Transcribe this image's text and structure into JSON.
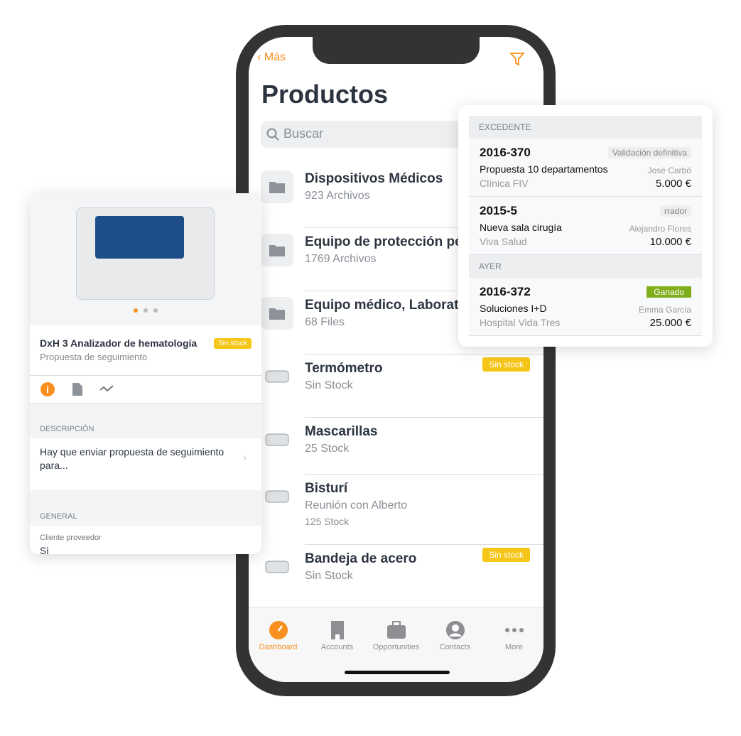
{
  "header": {
    "back_label": "Más",
    "title": "Productos",
    "search_placeholder": "Buscar"
  },
  "products": [
    {
      "title": "Dispositivos Médicos",
      "sub": "923 Archivos",
      "icon": "folder-icon"
    },
    {
      "title": "Equipo de protección pe",
      "sub": "1769 Archivos",
      "icon": "folder-icon"
    },
    {
      "title": "Equipo médico, Laborato",
      "sub": "68 Files",
      "icon": "folder-icon"
    },
    {
      "title": "Termómetro",
      "sub": "Sin Stock",
      "badge": "Sin stock",
      "icon": "monitor-image"
    },
    {
      "title": "Mascarillas",
      "sub": "25 Stock",
      "icon": "mask-image"
    },
    {
      "title": "Bisturí",
      "sub": "Reunión con Alberto",
      "sub2": "125 Stock",
      "icon": "scalpel-image"
    },
    {
      "title": "Bandeja de acero",
      "sub": "Sin Stock",
      "badge": "Sin stock",
      "icon": "tray-image"
    }
  ],
  "tabs": [
    {
      "label": "Dashboard",
      "active": true
    },
    {
      "label": "Accounts"
    },
    {
      "label": "Opportunities"
    },
    {
      "label": "Contacts"
    },
    {
      "label": "More"
    }
  ],
  "detail": {
    "title": "DxH 3 Analizador de hematología",
    "subtitle": "Propuesta de seguimiento",
    "badge": "Sin stock",
    "desc_header": "DESCRIPCIÓN",
    "desc": "Hay que enviar propuesta de seguimiento para...",
    "general_header": "GENERAL",
    "field_label": "Cliente proveedor",
    "field_value": "Si"
  },
  "opportunities": {
    "sections": [
      {
        "header": "EXCEDENTE",
        "items": [
          {
            "id": "2016-370",
            "name": "Propuesta 10 departamentos",
            "client": "Clínica FIV",
            "status": "Validación definitiva",
            "person": "José Carbó",
            "amount": "5.000 €"
          },
          {
            "id": "2015-5",
            "name": "Nueva sala cirugía",
            "client": "Viva Salud",
            "status": "rrador",
            "person": "Alejandro Flores",
            "amount": "10.000 €"
          }
        ]
      },
      {
        "header": "AYER",
        "items": [
          {
            "id": "2016-372",
            "name": "Soluciones I+D",
            "client": "Hospital Vida Tres",
            "status": "Ganado",
            "person": "Emma García",
            "amount": "25.000 €"
          }
        ]
      }
    ]
  },
  "colors": {
    "accent": "#f7901e",
    "badge": "#f5c518",
    "won": "#7fae1b",
    "frame": "#333333"
  }
}
